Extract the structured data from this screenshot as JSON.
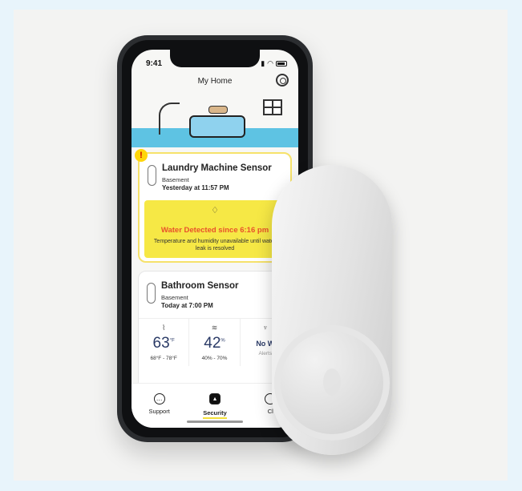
{
  "status": {
    "time": "9:41"
  },
  "header": {
    "title": "My Home"
  },
  "alert_card": {
    "badge": "!",
    "name": "Laundry Machine Sensor",
    "room": "Basement",
    "time": "Yesterday at 11:57 PM",
    "warning_title": "Water Detected since 6:16 pm",
    "warning_text": "Temperature and humidity unavailable until water leak is resolved"
  },
  "bath_card": {
    "name": "Bathroom Sensor",
    "room": "Basement",
    "time": "Today at 7:00 PM",
    "metrics": [
      {
        "value": "63",
        "unit": "°F",
        "sub": "68°F - 78°F"
      },
      {
        "value": "42",
        "unit": "%",
        "sub": "40% - 70%"
      },
      {
        "value": "No W",
        "unit": "",
        "sub": "Alerts"
      }
    ]
  },
  "tabs": [
    {
      "label": "Support"
    },
    {
      "label": "Security",
      "active": true
    },
    {
      "label": "Cl"
    }
  ],
  "colors": {
    "accent": "#f6e845",
    "warning": "#e8512b",
    "water": "#5ec3e3"
  }
}
